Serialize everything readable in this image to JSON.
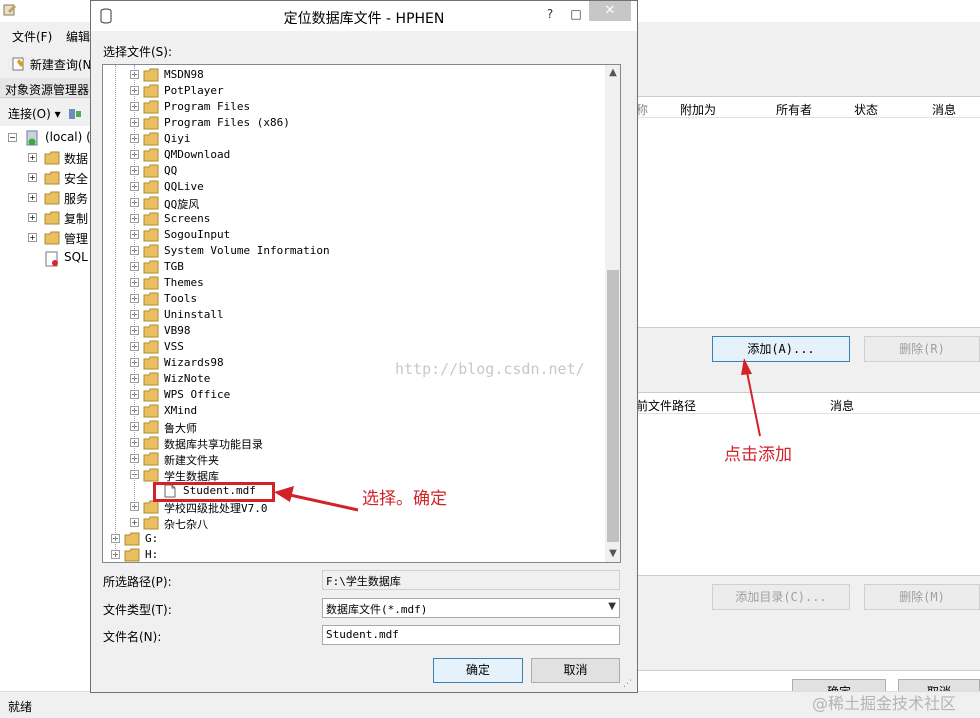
{
  "background": {
    "menu": [
      "文件(F)",
      "编辑"
    ],
    "new_query": "新建查询(N",
    "object_explorer": {
      "title": "对象资源管理器",
      "connect": "连接(O) ▾",
      "root": "(local) (",
      "items": [
        "数据",
        "安全",
        "服务",
        "复制",
        "管理",
        "SQL"
      ]
    },
    "status": "就绪"
  },
  "attach_dialog": {
    "grid1_columns": [
      "附加为",
      "所有者",
      "状态",
      "消息"
    ],
    "grid1_partial_col": "称",
    "add_button": "添加(A)...",
    "remove_button": "删除(R)",
    "grid2_columns": [
      "前文件路径",
      "消息"
    ],
    "add_dir_button": "添加目录(C)...",
    "remove2_button": "删除(M)",
    "ok_button": "确定",
    "cancel_button": "取消"
  },
  "locate_dialog": {
    "title": "定位数据库文件 - HPHEN",
    "select_label": "选择文件(S):",
    "tree": [
      {
        "name": "MSDN98",
        "level": 2,
        "expander": "+"
      },
      {
        "name": "PotPlayer",
        "level": 2,
        "expander": "+"
      },
      {
        "name": "Program Files",
        "level": 2,
        "expander": "+"
      },
      {
        "name": "Program Files (x86)",
        "level": 2,
        "expander": "+"
      },
      {
        "name": "Qiyi",
        "level": 2,
        "expander": "+"
      },
      {
        "name": "QMDownload",
        "level": 2,
        "expander": "+"
      },
      {
        "name": "QQ",
        "level": 2,
        "expander": "+"
      },
      {
        "name": "QQLive",
        "level": 2,
        "expander": "+"
      },
      {
        "name": "QQ旋风",
        "level": 2,
        "expander": "+"
      },
      {
        "name": "Screens",
        "level": 2,
        "expander": "+"
      },
      {
        "name": "SogouInput",
        "level": 2,
        "expander": "+"
      },
      {
        "name": "System Volume Information",
        "level": 2,
        "expander": "+"
      },
      {
        "name": "TGB",
        "level": 2,
        "expander": "+"
      },
      {
        "name": "Themes",
        "level": 2,
        "expander": "+"
      },
      {
        "name": "Tools",
        "level": 2,
        "expander": "+"
      },
      {
        "name": "Uninstall",
        "level": 2,
        "expander": "+"
      },
      {
        "name": "VB98",
        "level": 2,
        "expander": "+"
      },
      {
        "name": "VSS",
        "level": 2,
        "expander": "+"
      },
      {
        "name": "Wizards98",
        "level": 2,
        "expander": "+"
      },
      {
        "name": "WizNote",
        "level": 2,
        "expander": "+"
      },
      {
        "name": "WPS Office",
        "level": 2,
        "expander": "+"
      },
      {
        "name": "XMind",
        "level": 2,
        "expander": "+"
      },
      {
        "name": "鲁大师",
        "level": 2,
        "expander": "+"
      },
      {
        "name": "数据库共享功能目录",
        "level": 2,
        "expander": "+"
      },
      {
        "name": "新建文件夹",
        "level": 2,
        "expander": "+"
      },
      {
        "name": "学生数据库",
        "level": 2,
        "expander": "-"
      },
      {
        "name": "Student.mdf",
        "level": 3,
        "expander": "",
        "file": true,
        "selected": true
      },
      {
        "name": "学校四级批处理V7.0",
        "level": 2,
        "expander": "+"
      },
      {
        "name": "杂七杂八",
        "level": 2,
        "expander": "+"
      },
      {
        "name": "G:",
        "level": 1,
        "expander": "+"
      },
      {
        "name": "H:",
        "level": 1,
        "expander": "+"
      }
    ],
    "path_label": "所选路径(P):",
    "path_value": "F:\\学生数据库",
    "type_label": "文件类型(T):",
    "type_value": "数据库文件(*.mdf)",
    "name_label": "文件名(N):",
    "name_value": "Student.mdf",
    "ok": "确定",
    "cancel": "取消"
  },
  "annotations": {
    "select_ok": "选择。确定",
    "click_add": "点击添加",
    "watermark": "http://blog.csdn.net/",
    "footer": "@稀土掘金技术社区"
  },
  "colors": {
    "annotation": "#d2232a",
    "accent": "#3c7fb1"
  }
}
